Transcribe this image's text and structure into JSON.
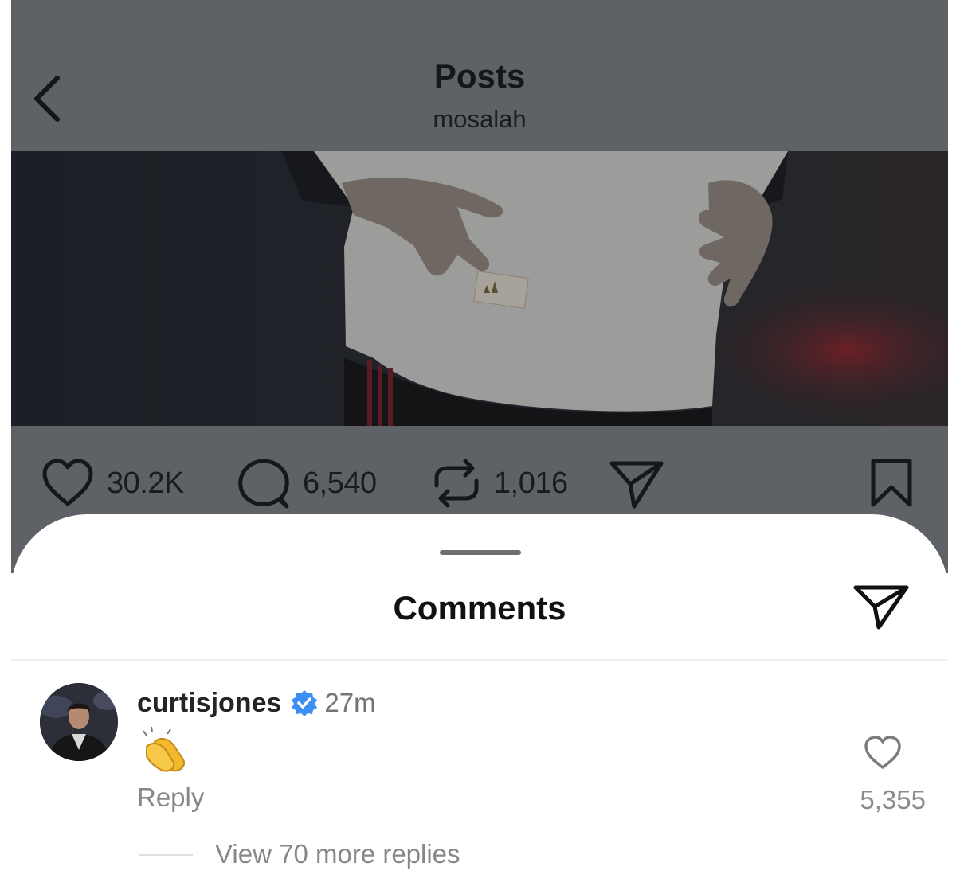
{
  "header": {
    "title": "Posts",
    "subtitle": "mosalah",
    "back_icon": "chevron-left-icon"
  },
  "post": {
    "image_description_icon": "photo",
    "actions": {
      "likes": {
        "icon": "heart-icon",
        "count": "30.2K"
      },
      "comments": {
        "icon": "comment-bubble-icon",
        "count": "6,540"
      },
      "reposts": {
        "icon": "repost-icon",
        "count": "1,016"
      },
      "share": {
        "icon": "paper-plane-icon"
      },
      "save": {
        "icon": "bookmark-icon"
      }
    }
  },
  "comments_sheet": {
    "title": "Comments",
    "share_icon": "paper-plane-icon",
    "comment": {
      "username": "curtisjones",
      "verified": true,
      "timestamp": "27m",
      "text": "👏",
      "reply_label": "Reply",
      "like_count": "5,355",
      "view_more_label": "View 70 more replies"
    }
  },
  "colors": {
    "overlay": "#5e6165",
    "verified_blue": "#3b8ff5",
    "muted_text": "#86878a"
  }
}
